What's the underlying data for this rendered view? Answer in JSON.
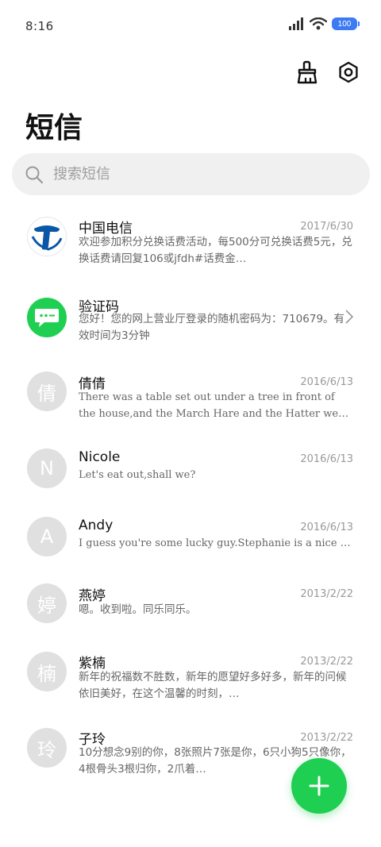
{
  "status": {
    "time": "8:16",
    "battery": "100"
  },
  "title": "短信",
  "search": {
    "placeholder": "搜索短信"
  },
  "conversations": [
    {
      "name": "中国电信",
      "date": "2017/6/30",
      "preview": "欢迎参加积分兑换话费活动，每500分可兑换话费5元，兑换话费请回复106或jfdh#话费金…",
      "avatar": "china-telecom-logo"
    },
    {
      "name": "验证码",
      "date": "",
      "preview": "您好！您的网上营业厅登录的随机密码为：710679。有效时间为3分钟",
      "avatar": "verification-message-icon"
    },
    {
      "name": "倩倩",
      "date": "2016/6/13",
      "preview": "There was a table set out under a tree in front of the house,and the March Hare and the Hatter were having…",
      "avatar": "倩"
    },
    {
      "name": "Nicole",
      "date": "2016/6/13",
      "preview": "Let's eat out,shall we?",
      "avatar": "N"
    },
    {
      "name": "Andy",
      "date": "2016/6/13",
      "preview": "I guess you're some lucky guy.Stephanie is a nice girl.",
      "avatar": "A"
    },
    {
      "name": "燕婷",
      "date": "2013/2/22",
      "preview": "嗯。收到啦。同乐同乐。",
      "avatar": "婷"
    },
    {
      "name": "紫楠",
      "date": "2013/2/22",
      "preview": "新年的祝福数不胜数，新年的愿望好多好多，新年的问候依旧美好，在这个温馨的时刻，…",
      "avatar": "楠"
    },
    {
      "name": "子玲",
      "date": "2013/2/22",
      "preview": "10分想念9别的你，8张照片7张是你，6只小狗5只像你，4根骨头3根归你，2爪着…",
      "avatar": "玲"
    }
  ],
  "colors": {
    "fab": "#1fcf52",
    "accent": "#3d7bf5",
    "avatar_bg": "#e0e0e0"
  }
}
